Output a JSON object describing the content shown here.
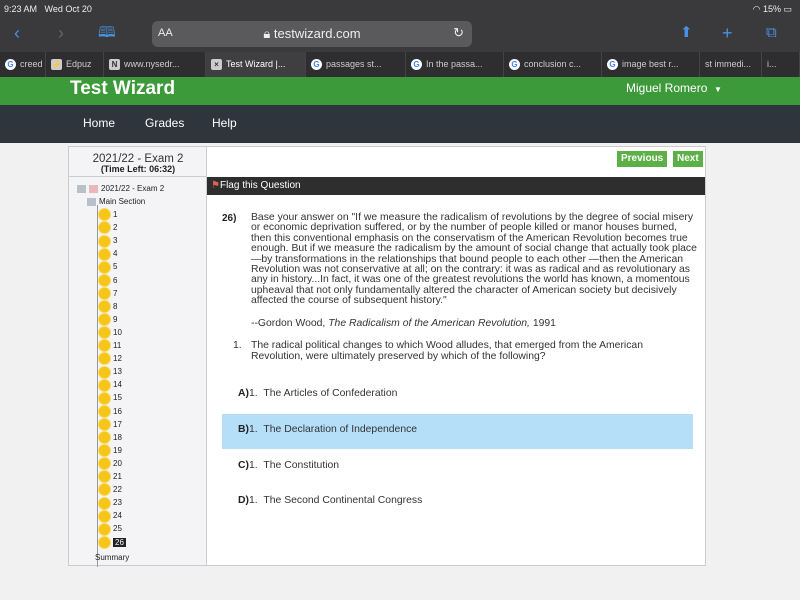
{
  "status_bar": {
    "time": "9:23 AM",
    "date": "Wed Oct 20",
    "battery": "15%"
  },
  "browser": {
    "text_size": "AA",
    "url": "testwizard.com",
    "tabs": [
      {
        "label": "creed",
        "icon": "google-icon"
      },
      {
        "label": "Edpuz",
        "icon": "edpuzzle-icon"
      },
      {
        "label": "www.nysedr...",
        "icon": "notion-icon"
      },
      {
        "label": "Test Wizard |...",
        "icon": "close-icon",
        "active": true
      },
      {
        "label": "passages st...",
        "icon": "google-icon"
      },
      {
        "label": "In the passa...",
        "icon": "google-icon"
      },
      {
        "label": "conclusion c...",
        "icon": "google-icon"
      },
      {
        "label": "image best r...",
        "icon": "google-icon"
      },
      {
        "label": "st immedi...",
        "icon": ""
      },
      {
        "label": "i...",
        "icon": ""
      }
    ]
  },
  "header": {
    "brand": "Test Wizard",
    "user": "Miguel Romero"
  },
  "nav": {
    "items": [
      "Home",
      "Grades",
      "Help"
    ]
  },
  "exam": {
    "title": "2021/22 - Exam 2",
    "time_left": "(Time Left: 06:32)"
  },
  "tree": {
    "root": "2021/22 - Exam 2",
    "section": "Main Section",
    "questions": [
      "1",
      "2",
      "3",
      "4",
      "5",
      "6",
      "7",
      "8",
      "9",
      "10",
      "11",
      "12",
      "13",
      "14",
      "15",
      "16",
      "17",
      "18",
      "19",
      "20",
      "21",
      "22",
      "23",
      "24",
      "25",
      "26"
    ],
    "current": "26",
    "summary": "Summary"
  },
  "buttons": {
    "previous": "Previous",
    "next": "Next"
  },
  "flag_label": "Flag this Question",
  "question": {
    "number": "26)",
    "text": "Base your answer on \"If we measure the radicalism of revolutions by the degree of social misery or economic deprivation suffered, or by the number of people killed or manor houses burned, then this conventional emphasis on the conservatism of the American Revolution becomes true enough. But if we measure the radicalism by the amount of social change that actually took place—by transformations in the relationships that bound people to each other —then the American Revolution was not conservative at all; on the contrary: it was as radical and as revolutionary as any in history...In fact, it was one of the greatest revolutions the world has known, a momentous upheaval that not only fundamentally altered the character of American society but decisively affected the course of subsequent history.\"",
    "cite_author": "--Gordon Wood, ",
    "cite_title": "The Radicalism of the American Revolution,",
    "cite_year": " 1991",
    "sub_number": "1.",
    "sub_text": "The radical political changes to which Wood alludes, that emerged from the American Revolution, were ultimately preserved by which of the following?",
    "options": [
      {
        "letter": "A)",
        "num": "1.",
        "text": "The Articles of Confederation",
        "selected": false
      },
      {
        "letter": "B)",
        "num": "1.",
        "text": "The Declaration of Independence",
        "selected": true
      },
      {
        "letter": "C)",
        "num": "1.",
        "text": "The Constitution",
        "selected": false
      },
      {
        "letter": "D)",
        "num": "1.",
        "text": "The Second Continental Congress",
        "selected": false
      }
    ]
  },
  "colors": {
    "brand_green": "#3d9a3a",
    "button_green": "#5cb046",
    "selected_option": "#b5dff9",
    "nav_bg": "#2f353c"
  }
}
